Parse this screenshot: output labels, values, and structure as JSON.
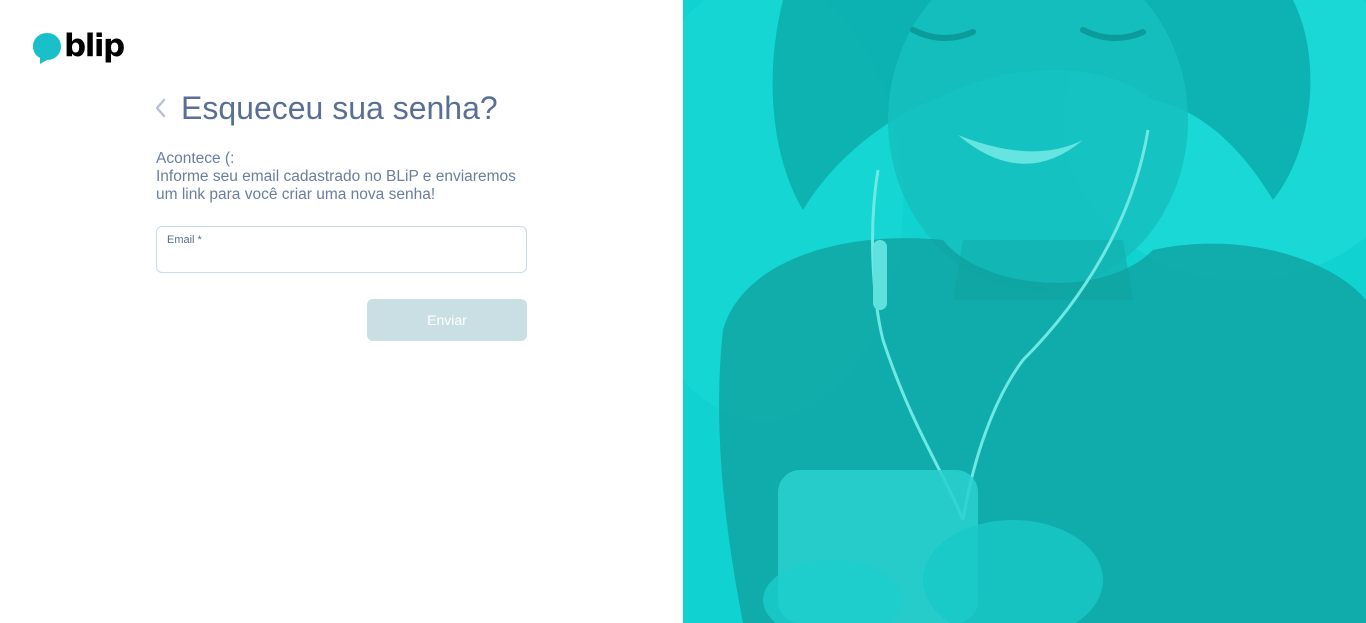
{
  "brand": {
    "name": "blip",
    "bubble_color": "#1ac0c9"
  },
  "header": {
    "title": "Esqueceu sua senha?",
    "back_icon": "chevron-left-icon"
  },
  "description": {
    "line1": "Acontece (:",
    "line2": "Informe seu email cadastrado no BLiP e enviaremos",
    "line3": "um link para você criar uma nova senha!"
  },
  "form": {
    "email_label": "Email *",
    "email_value": "",
    "submit_label": "Enviar",
    "submit_disabled": true
  },
  "colors": {
    "title": "#5a6f95",
    "text": "#6a7e9f",
    "button_disabled": "#c9dfe4",
    "hero_tint": "#12d3d1"
  }
}
